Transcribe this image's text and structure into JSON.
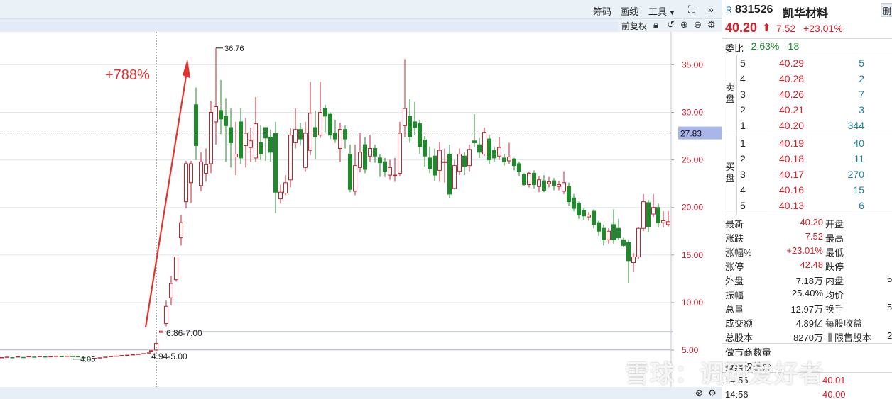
{
  "toolbar": {
    "chips": "筹码",
    "draw": "画线",
    "tools": "工具",
    "sub_adjust": "前复权"
  },
  "chart_data": {
    "type": "candlestick",
    "y_ticks": [
      "35.00",
      "30.00",
      "25.00",
      "20.00",
      "15.00",
      "10.00",
      "5.00"
    ],
    "ylim": [
      3.5,
      38.5
    ],
    "crosshair_price": "27.83",
    "annotation_gain": "+788%",
    "annotations": {
      "high": "36.76",
      "range_a": "6.86-7.00",
      "range_b": "4.94-5.00",
      "low_flat": "4.05"
    },
    "candles": [
      {
        "o": 4.9,
        "c": 4.94,
        "h": 5.0,
        "l": 4.86
      },
      {
        "o": 5.0,
        "c": 5.7,
        "h": 6.2,
        "l": 4.94
      },
      {
        "o": 6.86,
        "c": 7.0,
        "h": 7.0,
        "l": 6.86
      },
      {
        "o": 7.8,
        "c": 9.6,
        "h": 10.2,
        "l": 7.5
      },
      {
        "o": 10.5,
        "c": 12.0,
        "h": 12.8,
        "l": 9.7
      },
      {
        "o": 12.4,
        "c": 14.8,
        "h": 14.8,
        "l": 12.2
      },
      {
        "o": 16.8,
        "c": 18.4,
        "h": 19.2,
        "l": 16.0
      },
      {
        "o": 20.6,
        "c": 24.6,
        "h": 24.9,
        "l": 19.9
      },
      {
        "o": 22.6,
        "c": 24.6,
        "h": 24.9,
        "l": 20.5
      },
      {
        "o": 30.8,
        "c": 26.5,
        "h": 32.6,
        "l": 25.0
      },
      {
        "o": 22.3,
        "c": 24.8,
        "h": 25.8,
        "l": 21.7
      },
      {
        "o": 23.6,
        "c": 24.5,
        "h": 26.2,
        "l": 22.7
      },
      {
        "o": 24.6,
        "c": 30.0,
        "h": 31.2,
        "l": 23.6
      },
      {
        "o": 29.0,
        "c": 30.6,
        "h": 36.76,
        "l": 26.6
      },
      {
        "o": 30.2,
        "c": 29.3,
        "h": 33.4,
        "l": 27.7
      },
      {
        "o": 29.6,
        "c": 28.6,
        "h": 31.5,
        "l": 24.8
      },
      {
        "o": 28.4,
        "c": 26.8,
        "h": 30.4,
        "l": 24.2
      },
      {
        "o": 25.3,
        "c": 25.6,
        "h": 29.0,
        "l": 23.4
      },
      {
        "o": 29.0,
        "c": 25.2,
        "h": 30.4,
        "l": 24.6
      },
      {
        "o": 26.5,
        "c": 27.8,
        "h": 29.4,
        "l": 24.2
      },
      {
        "o": 26.3,
        "c": 27.0,
        "h": 28.4,
        "l": 24.8
      },
      {
        "o": 25.2,
        "c": 28.8,
        "h": 31.6,
        "l": 24.8
      },
      {
        "o": 26.8,
        "c": 25.6,
        "h": 28.6,
        "l": 25.0
      },
      {
        "o": 28.4,
        "c": 27.3,
        "h": 28.4,
        "l": 24.9
      },
      {
        "o": 27.4,
        "c": 25.8,
        "h": 28.2,
        "l": 24.8
      },
      {
        "o": 27.8,
        "c": 21.6,
        "h": 29.0,
        "l": 19.4
      },
      {
        "o": 20.9,
        "c": 21.6,
        "h": 22.4,
        "l": 20.4
      },
      {
        "o": 21.5,
        "c": 22.6,
        "h": 23.4,
        "l": 21.3
      },
      {
        "o": 22.9,
        "c": 27.6,
        "h": 28.4,
        "l": 22.1
      },
      {
        "o": 26.8,
        "c": 28.2,
        "h": 30.4,
        "l": 26.2
      },
      {
        "o": 28.2,
        "c": 27.2,
        "h": 28.9,
        "l": 26.5
      },
      {
        "o": 24.2,
        "c": 27.8,
        "h": 29.0,
        "l": 23.8
      },
      {
        "o": 26.0,
        "c": 29.9,
        "h": 33.2,
        "l": 25.5
      },
      {
        "o": 28.4,
        "c": 27.4,
        "h": 30.2,
        "l": 25.1
      },
      {
        "o": 27.6,
        "c": 30.0,
        "h": 33.2,
        "l": 27.3
      },
      {
        "o": 30.4,
        "c": 29.6,
        "h": 30.8,
        "l": 27.9
      },
      {
        "o": 29.8,
        "c": 27.6,
        "h": 30.0,
        "l": 27.2
      },
      {
        "o": 27.8,
        "c": 27.2,
        "h": 29.2,
        "l": 26.8
      },
      {
        "o": 26.2,
        "c": 28.2,
        "h": 28.9,
        "l": 24.8
      },
      {
        "o": 28.2,
        "c": 27.2,
        "h": 28.6,
        "l": 26.2
      },
      {
        "o": 25.6,
        "c": 21.9,
        "h": 26.6,
        "l": 21.6
      },
      {
        "o": 21.7,
        "c": 24.4,
        "h": 26.6,
        "l": 21.3
      },
      {
        "o": 24.2,
        "c": 25.8,
        "h": 27.8,
        "l": 23.7
      },
      {
        "o": 26.6,
        "c": 24.0,
        "h": 27.4,
        "l": 23.6
      },
      {
        "o": 25.4,
        "c": 26.2,
        "h": 27.6,
        "l": 24.8
      },
      {
        "o": 26.2,
        "c": 25.4,
        "h": 26.6,
        "l": 24.7
      },
      {
        "o": 25.2,
        "c": 24.7,
        "h": 25.6,
        "l": 23.2
      },
      {
        "o": 24.8,
        "c": 23.8,
        "h": 25.2,
        "l": 23.2
      },
      {
        "o": 23.4,
        "c": 24.2,
        "h": 25.0,
        "l": 22.9
      },
      {
        "o": 23.4,
        "c": 23.4,
        "h": 25.2,
        "l": 22.7
      },
      {
        "o": 23.6,
        "c": 27.8,
        "h": 29.0,
        "l": 23.3
      },
      {
        "o": 28.6,
        "c": 30.4,
        "h": 35.6,
        "l": 27.4
      },
      {
        "o": 29.6,
        "c": 27.4,
        "h": 31.4,
        "l": 26.8
      },
      {
        "o": 29.0,
        "c": 28.4,
        "h": 31.1,
        "l": 27.6
      },
      {
        "o": 28.8,
        "c": 26.4,
        "h": 29.2,
        "l": 25.6
      },
      {
        "o": 27.1,
        "c": 25.4,
        "h": 27.5,
        "l": 24.3
      },
      {
        "o": 25.2,
        "c": 24.1,
        "h": 26.4,
        "l": 23.6
      },
      {
        "o": 25.4,
        "c": 23.4,
        "h": 26.2,
        "l": 22.8
      },
      {
        "o": 23.9,
        "c": 26.0,
        "h": 26.9,
        "l": 22.7
      },
      {
        "o": 24.8,
        "c": 24.8,
        "h": 26.2,
        "l": 22.6
      },
      {
        "o": 25.6,
        "c": 21.4,
        "h": 26.6,
        "l": 21.0
      },
      {
        "o": 22.0,
        "c": 24.4,
        "h": 25.0,
        "l": 21.9
      },
      {
        "o": 23.8,
        "c": 25.6,
        "h": 26.2,
        "l": 23.4
      },
      {
        "o": 25.4,
        "c": 24.3,
        "h": 25.8,
        "l": 23.4
      },
      {
        "o": 24.4,
        "c": 26.1,
        "h": 26.6,
        "l": 23.8
      },
      {
        "o": 27.0,
        "c": 26.8,
        "h": 29.8,
        "l": 26.3
      },
      {
        "o": 26.6,
        "c": 25.8,
        "h": 27.3,
        "l": 25.2
      },
      {
        "o": 25.6,
        "c": 27.9,
        "h": 28.4,
        "l": 25.4
      },
      {
        "o": 27.2,
        "c": 25.0,
        "h": 27.6,
        "l": 24.6
      },
      {
        "o": 26.0,
        "c": 25.2,
        "h": 26.4,
        "l": 24.8
      },
      {
        "o": 25.4,
        "c": 26.3,
        "h": 27.4,
        "l": 25.0
      },
      {
        "o": 25.2,
        "c": 24.8,
        "h": 25.6,
        "l": 24.4
      },
      {
        "o": 24.9,
        "c": 25.3,
        "h": 26.8,
        "l": 24.6
      },
      {
        "o": 25.1,
        "c": 24.4,
        "h": 25.2,
        "l": 23.9
      },
      {
        "o": 24.6,
        "c": 23.8,
        "h": 24.8,
        "l": 23.3
      },
      {
        "o": 23.5,
        "c": 22.4,
        "h": 23.6,
        "l": 22.2
      },
      {
        "o": 22.4,
        "c": 23.6,
        "h": 23.8,
        "l": 22.1
      },
      {
        "o": 23.6,
        "c": 22.4,
        "h": 23.9,
        "l": 22.0
      },
      {
        "o": 22.2,
        "c": 22.9,
        "h": 23.3,
        "l": 21.6
      },
      {
        "o": 22.8,
        "c": 21.8,
        "h": 23.4,
        "l": 21.6
      },
      {
        "o": 22.5,
        "c": 22.7,
        "h": 23.2,
        "l": 22.1
      },
      {
        "o": 22.8,
        "c": 22.3,
        "h": 23.1,
        "l": 21.8
      },
      {
        "o": 22.2,
        "c": 22.4,
        "h": 22.8,
        "l": 21.8
      },
      {
        "o": 21.7,
        "c": 22.6,
        "h": 23.8,
        "l": 21.4
      },
      {
        "o": 22.2,
        "c": 20.6,
        "h": 22.6,
        "l": 20.2
      },
      {
        "o": 21.0,
        "c": 19.9,
        "h": 21.4,
        "l": 19.6
      },
      {
        "o": 20.4,
        "c": 19.2,
        "h": 20.6,
        "l": 18.8
      },
      {
        "o": 19.7,
        "c": 19.1,
        "h": 19.9,
        "l": 18.7
      },
      {
        "o": 19.0,
        "c": 19.2,
        "h": 19.5,
        "l": 18.6
      },
      {
        "o": 19.6,
        "c": 18.2,
        "h": 19.8,
        "l": 17.8
      },
      {
        "o": 18.4,
        "c": 17.5,
        "h": 18.6,
        "l": 17.0
      },
      {
        "o": 17.8,
        "c": 16.6,
        "h": 18.2,
        "l": 16.0
      },
      {
        "o": 16.6,
        "c": 17.5,
        "h": 17.8,
        "l": 16.2
      },
      {
        "o": 18.2,
        "c": 16.6,
        "h": 19.8,
        "l": 16.2
      },
      {
        "o": 17.8,
        "c": 16.8,
        "h": 18.8,
        "l": 16.6
      },
      {
        "o": 16.6,
        "c": 16.0,
        "h": 16.8,
        "l": 15.8
      },
      {
        "o": 16.3,
        "c": 14.4,
        "h": 16.6,
        "l": 12.0
      },
      {
        "o": 14.2,
        "c": 14.8,
        "h": 15.2,
        "l": 13.2
      },
      {
        "o": 14.8,
        "c": 17.8,
        "h": 17.9,
        "l": 14.6
      },
      {
        "o": 17.8,
        "c": 20.6,
        "h": 21.4,
        "l": 17.5
      },
      {
        "o": 20.5,
        "c": 18.0,
        "h": 20.8,
        "l": 17.4
      },
      {
        "o": 19.3,
        "c": 20.0,
        "h": 21.4,
        "l": 19.0
      },
      {
        "o": 20.0,
        "c": 18.4,
        "h": 20.4,
        "l": 17.9
      },
      {
        "o": 18.4,
        "c": 18.6,
        "h": 19.6,
        "l": 17.9
      },
      {
        "o": 18.2,
        "c": 18.5,
        "h": 19.6,
        "l": 18.0
      }
    ],
    "flat_prices": [
      4.2,
      4.25,
      4.2,
      4.28,
      4.22,
      4.3,
      4.26,
      4.32,
      4.28,
      4.3,
      4.34,
      4.31,
      4.35,
      4.33,
      4.3,
      4.2,
      4.05,
      4.12,
      4.18,
      4.25,
      4.32,
      4.36,
      4.42,
      4.46,
      4.5,
      4.55,
      4.62,
      4.7
    ]
  },
  "quote": {
    "market_tag": "R",
    "code": "831526",
    "name": "凯华材料",
    "corner_btn": "删",
    "price": "40.20",
    "change": "7.52",
    "change_pct": "+23.01%",
    "weibi_label": "委比",
    "weibi_pct": "-2.63%",
    "weibi_diff": "-18",
    "sell_label": "卖盘",
    "buy_label": "买盘",
    "sell": [
      {
        "lvl": "5",
        "price": "40.29",
        "vol": "5"
      },
      {
        "lvl": "4",
        "price": "40.28",
        "vol": "2"
      },
      {
        "lvl": "3",
        "price": "40.26",
        "vol": "7"
      },
      {
        "lvl": "2",
        "price": "40.21",
        "vol": "3"
      },
      {
        "lvl": "1",
        "price": "40.20",
        "vol": "344"
      }
    ],
    "buy": [
      {
        "lvl": "1",
        "price": "40.19",
        "vol": "40"
      },
      {
        "lvl": "2",
        "price": "40.18",
        "vol": "11"
      },
      {
        "lvl": "3",
        "price": "40.17",
        "vol": "270"
      },
      {
        "lvl": "4",
        "price": "40.16",
        "vol": "15"
      },
      {
        "lvl": "5",
        "price": "40.13",
        "vol": "6"
      }
    ],
    "stats": [
      {
        "label": "最新",
        "value": "40.20",
        "label2": "开盘",
        "value2": ""
      },
      {
        "label": "涨跌",
        "value": "7.52",
        "label2": "最高",
        "value2": ""
      },
      {
        "label": "涨幅%",
        "value": "+23.01%",
        "label2": "最低",
        "value2": ""
      },
      {
        "label": "涨停",
        "value": "42.48",
        "label2": "跌停",
        "value2": ""
      },
      {
        "label": "外盘",
        "value": "7.18万",
        "label2": "内盘",
        "value2": "5"
      },
      {
        "label": "振幅",
        "value": "25.40%",
        "label2": "均价",
        "value2": ""
      },
      {
        "label": "总量",
        "value": "12.97万",
        "label2": "换手",
        "value2": "5"
      },
      {
        "label": "成交额",
        "value": "4.89亿",
        "label2": "每股收益",
        "value2": ""
      },
      {
        "label": "总股本",
        "value": "8270万",
        "label2": "非限售股本",
        "value2": "2"
      }
    ],
    "market_maker_label": "做市商数量",
    "investor_label": "投票权差异",
    "ticks": [
      {
        "time": "14:56",
        "price": "40.01"
      },
      {
        "time": "14:56",
        "price": "40.00"
      }
    ]
  },
  "watermark": "雪球：调研爱好者",
  "colors": {
    "up": "#c8202c",
    "down": "#1f8a2b",
    "accent_red": "#e5322d",
    "crosshair_tag": "#a9b6ea"
  }
}
